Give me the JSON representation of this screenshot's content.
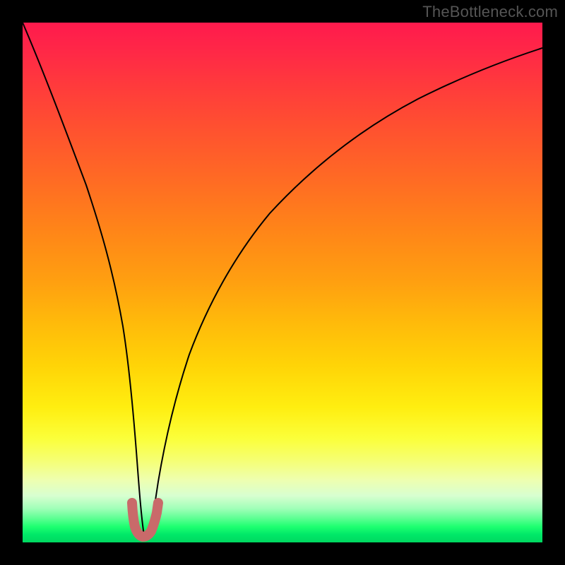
{
  "watermark": "TheBottleneck.com",
  "chart_data": {
    "type": "line",
    "title": "",
    "xlabel": "",
    "ylabel": "",
    "xlim": [
      0,
      100
    ],
    "ylim": [
      0,
      100
    ],
    "grid": false,
    "background_gradient": {
      "direction": "vertical",
      "stops": [
        {
          "pos": 0.0,
          "color": "#ff1a4d"
        },
        {
          "pos": 0.5,
          "color": "#ffa010"
        },
        {
          "pos": 0.8,
          "color": "#fbff3a"
        },
        {
          "pos": 0.95,
          "color": "#58ff90"
        },
        {
          "pos": 1.0,
          "color": "#00d860"
        }
      ]
    },
    "series": [
      {
        "name": "bottleneck-curve",
        "color": "#000000",
        "stroke_width": 2,
        "x": [
          0,
          2,
          4,
          6,
          8,
          10,
          12,
          14,
          16,
          18,
          19,
          20,
          21,
          22,
          23,
          24,
          25,
          26,
          28,
          30,
          34,
          40,
          46,
          54,
          62,
          72,
          82,
          92,
          100
        ],
        "y": [
          100,
          91,
          82,
          73,
          64,
          55,
          46,
          37,
          28,
          18,
          13,
          8,
          4,
          1.5,
          1.0,
          1.5,
          4,
          8,
          15,
          21,
          31,
          42,
          50,
          58,
          64,
          70,
          75,
          79,
          82
        ]
      },
      {
        "name": "optimal-marker",
        "color": "#c96a6a",
        "type": "line",
        "stroke_width": 10,
        "linecap": "round",
        "x": [
          20.3,
          20.7,
          21.3,
          22.0,
          23.0,
          24.0,
          24.7,
          25.3,
          25.7
        ],
        "y": [
          7.0,
          4.0,
          2.0,
          1.2,
          1.0,
          1.2,
          2.0,
          4.0,
          7.0
        ]
      }
    ],
    "notch": {
      "x": 23,
      "y_range": [
        0,
        8
      ],
      "description": "optimal balance point (minimum bottleneck)"
    }
  }
}
